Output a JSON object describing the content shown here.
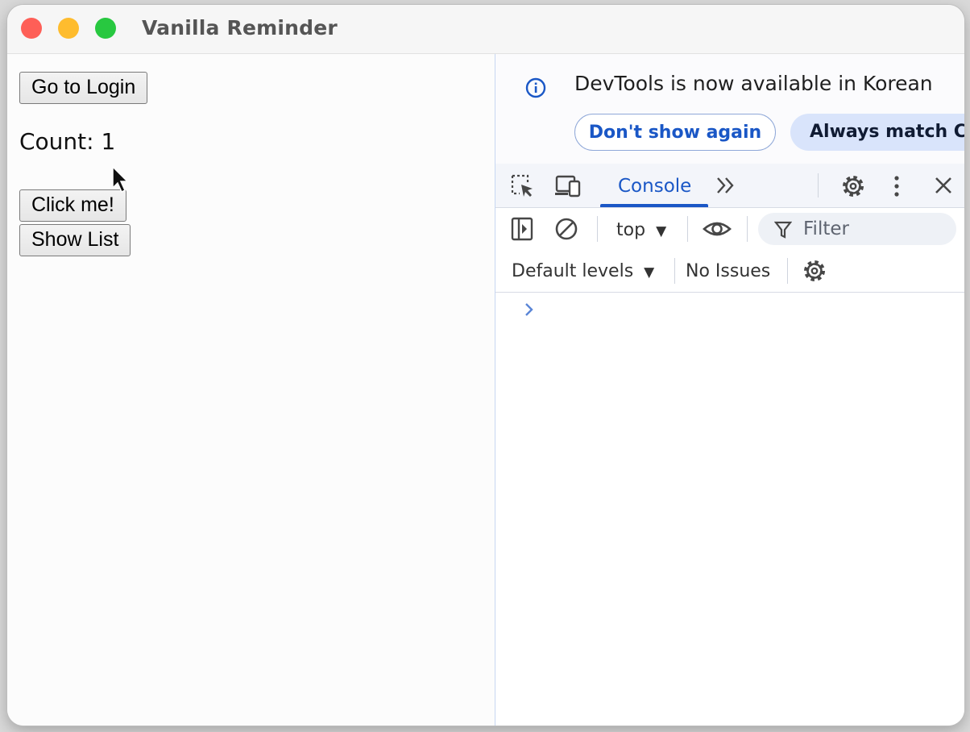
{
  "window": {
    "title": "Vanilla Reminder"
  },
  "page": {
    "login_button": "Go to Login",
    "count_text": "Count: 1",
    "click_button": "Click me!",
    "show_list_button": "Show List"
  },
  "devtools": {
    "infobar": {
      "message": "DevTools is now available in Korean",
      "dont_show_button": "Don't show again",
      "always_match_button": "Always match Ch"
    },
    "tabs": {
      "active_tab": "Console"
    },
    "toolbar": {
      "context": "top",
      "filter_placeholder": "Filter",
      "levels": "Default levels",
      "issues": "No Issues"
    }
  },
  "icons": {
    "inspect": "inspect-element-icon",
    "device": "device-toolbar-icon",
    "more_tabs": "chevron-double-right-icon",
    "settings": "gear-icon",
    "menu": "kebab-menu-icon",
    "close": "close-icon",
    "sidebar": "sidebar-toggle-icon",
    "clear": "clear-console-icon",
    "eye": "live-expression-eye-icon",
    "filter": "filter-funnel-icon",
    "info": "info-icon",
    "prompt": "chevron-right-icon"
  },
  "colors": {
    "accent": "#1a57c6",
    "close_button": "#fe5f57",
    "minimize_button": "#febc2e",
    "zoom_button": "#28c840"
  }
}
